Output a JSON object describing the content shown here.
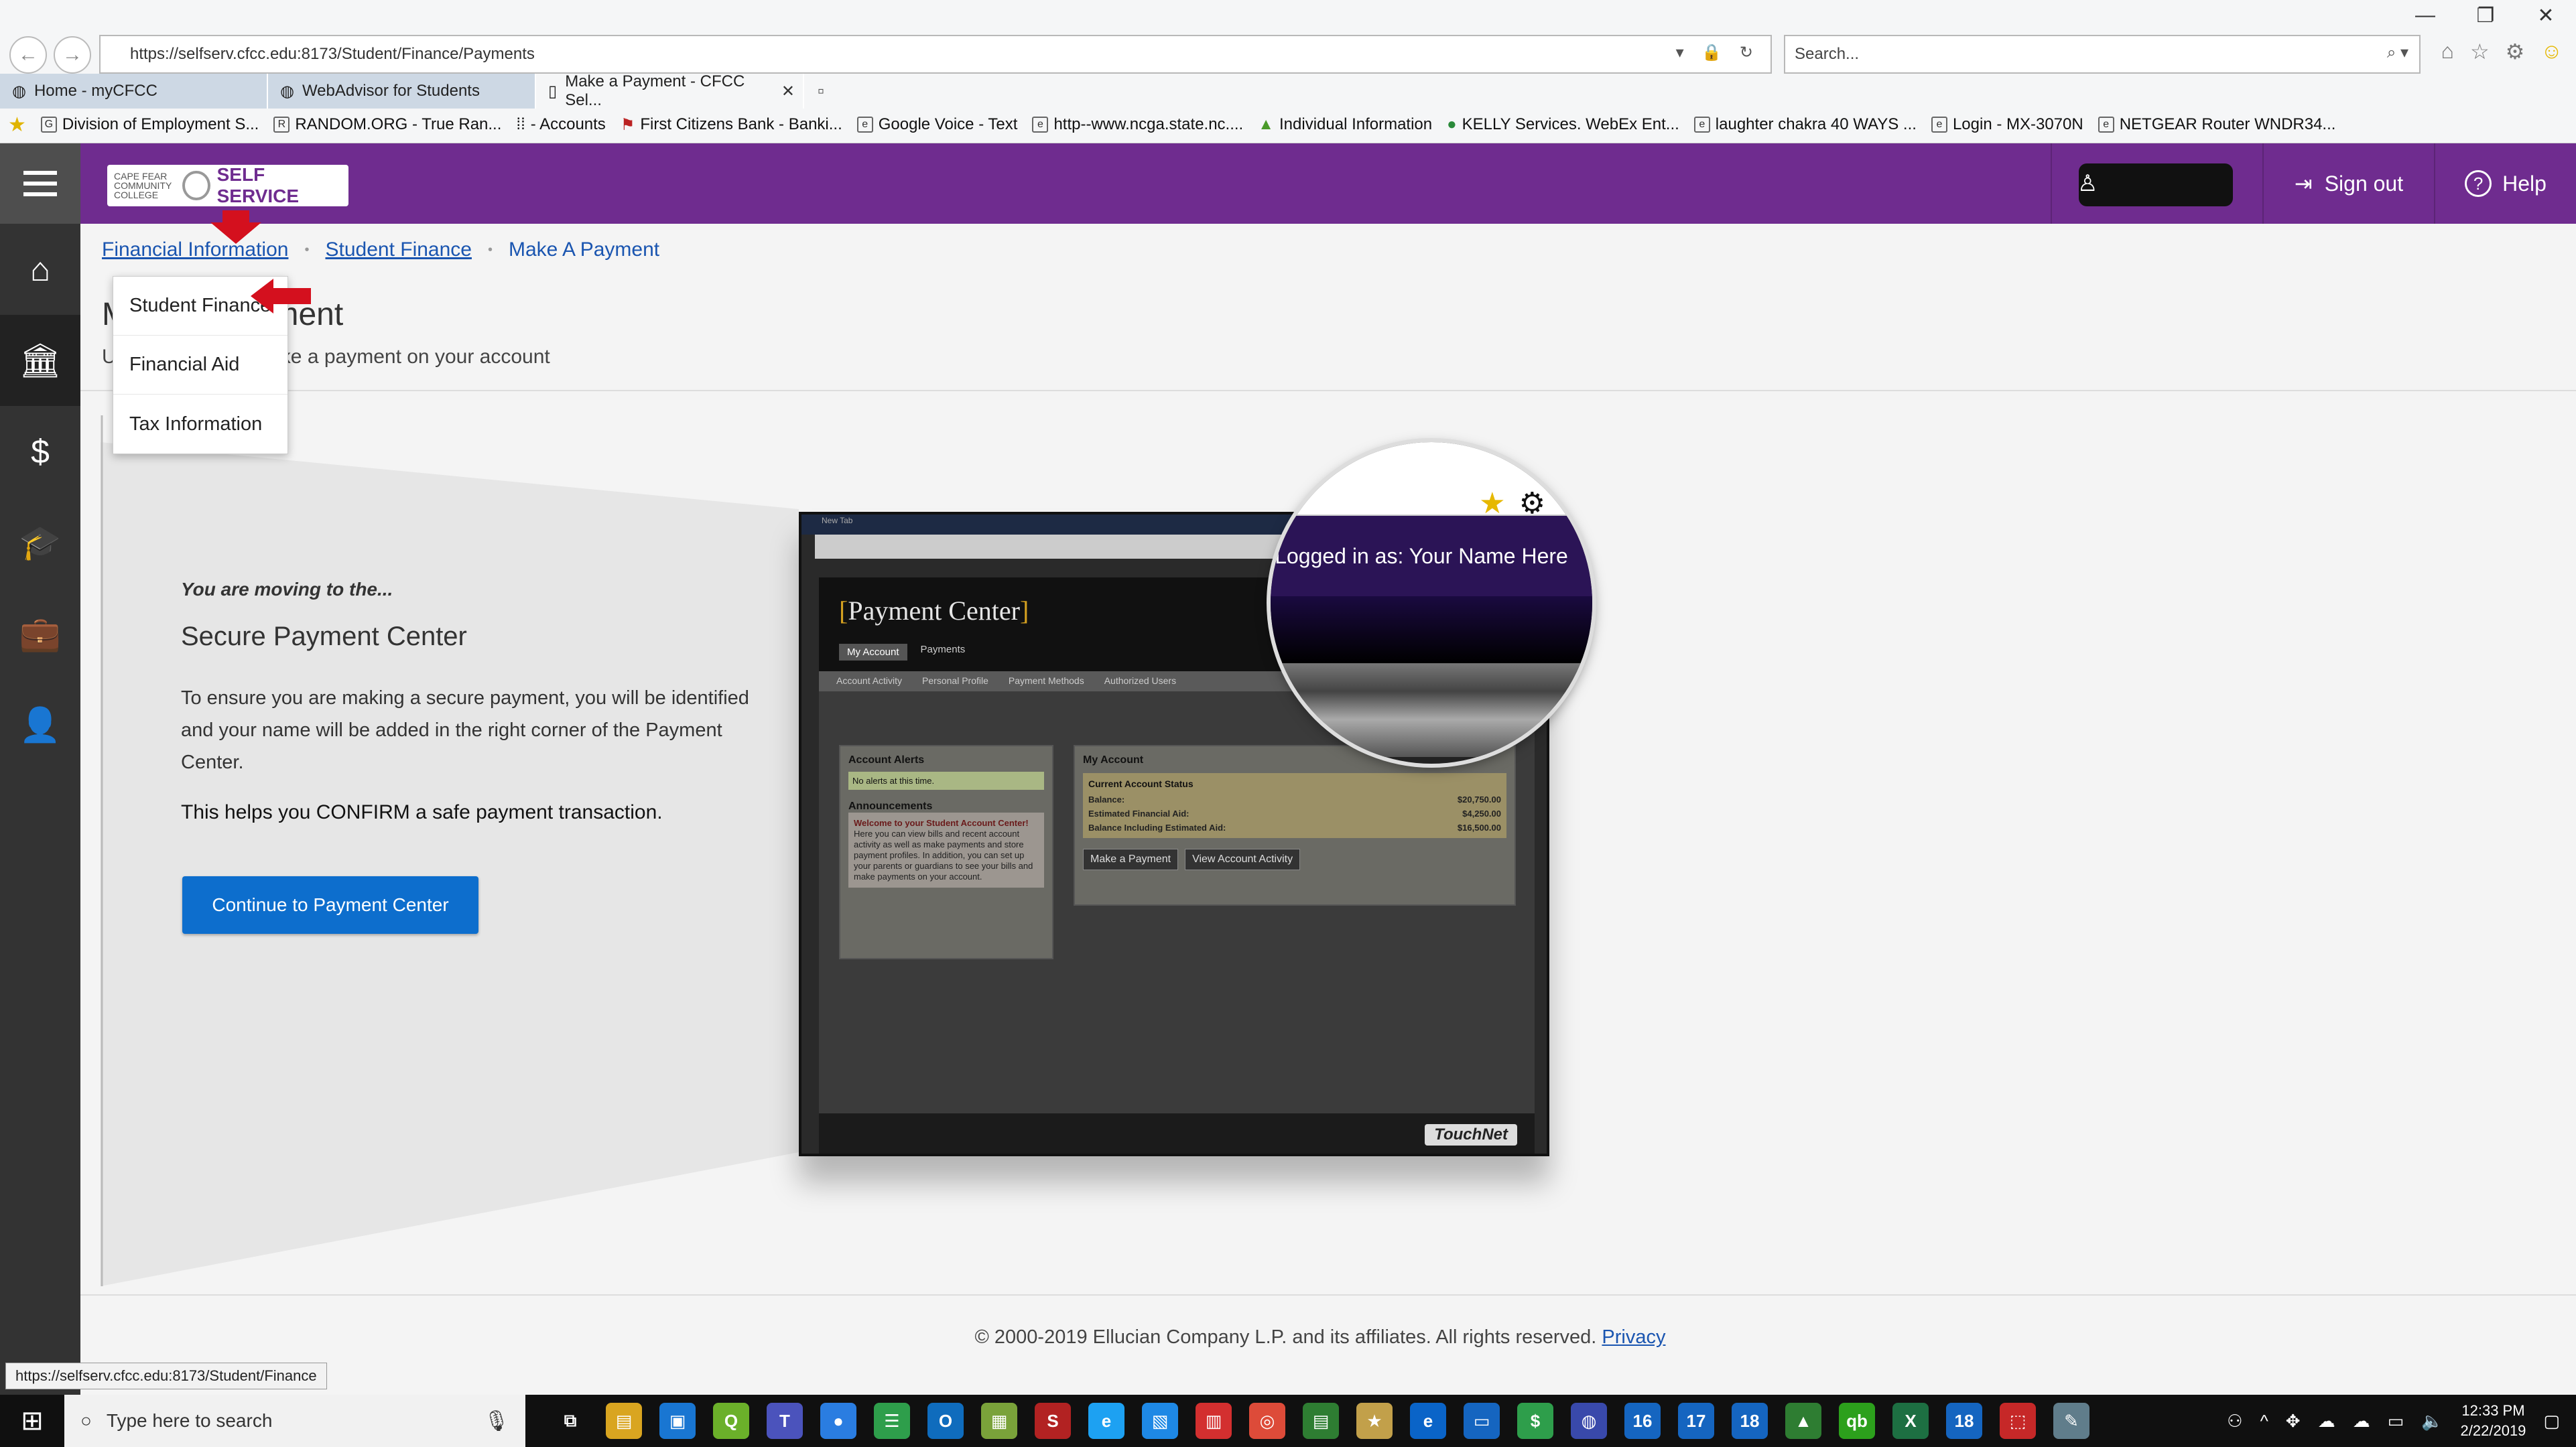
{
  "browser": {
    "window_controls": [
      "—",
      "❐",
      "✕"
    ],
    "address": "https://selfserv.cfcc.edu:8173/Student/Finance/Payments",
    "search_placeholder": "Search...",
    "tabs": [
      {
        "label": "Home - myCFCC",
        "active": false
      },
      {
        "label": "WebAdvisor for Students",
        "active": false
      },
      {
        "label": "Make a Payment - CFCC Sel...",
        "active": true
      }
    ],
    "favorites": [
      "Division of Employment S...",
      "RANDOM.ORG - True Ran...",
      "- Accounts",
      "First Citizens Bank - Banki...",
      "Google Voice - Text",
      "http--www.ncga.state.nc....",
      "Individual Information",
      "KELLY Services. WebEx Ent...",
      "laughter chakra 40 WAYS ...",
      "Login - MX-3070N",
      "NETGEAR Router WNDR34..."
    ]
  },
  "header": {
    "logo_small": "CAPE FEAR COMMUNITY COLLEGE",
    "logo_label": "SELF SERVICE",
    "sign_out": "Sign out",
    "help": "Help",
    "brand_color": "#6f2c8f"
  },
  "sidebar": {
    "items": [
      {
        "icon": "home-icon",
        "glyph": "⌂"
      },
      {
        "icon": "bank-icon",
        "glyph": "🏛"
      },
      {
        "icon": "finance-icon",
        "glyph": "$"
      },
      {
        "icon": "graduation-cap-icon",
        "glyph": "🎓"
      },
      {
        "icon": "briefcase-icon",
        "glyph": "💼"
      },
      {
        "icon": "user-icon",
        "glyph": "👤"
      }
    ]
  },
  "breadcrumb": {
    "item1": "Financial Information",
    "item2": "Student Finance",
    "current": "Make A Payment"
  },
  "page": {
    "title": "Make A Payment",
    "subtitle": "Use this page to make a payment on your account"
  },
  "dropdown": {
    "items": [
      "Student Finance",
      "Financial Aid",
      "Tax Information"
    ]
  },
  "payment_info": {
    "moving_text": "You are moving to the...",
    "title": "Secure Payment Center",
    "description": "To ensure you are making a secure payment, you will be identified and your name will be added in the right corner of the Payment Center.",
    "confirm": "This helps you CONFIRM a safe payment transaction.",
    "button": "Continue to Payment Center"
  },
  "mockup": {
    "tab": "New Tab",
    "pc_title": "Payment Center",
    "nav": [
      "My Account",
      "Payments"
    ],
    "subnav": [
      "Account Activity",
      "Personal Profile",
      "Payment Methods",
      "Authorized Users"
    ],
    "alerts_title": "Account Alerts",
    "alerts_none": "No alerts at this time.",
    "announcements_title": "Announcements",
    "announcement_head": "Welcome to your Student Account Center!",
    "announcement_body": "Here you can view bills and recent account activity as well as make payments and store payment profiles. In addition, you can set up your parents or guardians to see your bills and make payments on your account.",
    "account_title": "My Account",
    "status_title": "Current Account Status",
    "rows": [
      {
        "label": "Balance:",
        "value": "$20,750.00"
      },
      {
        "label": "Estimated Financial Aid:",
        "value": "$4,250.00"
      },
      {
        "label": "Balance Including Estimated Aid:",
        "value": "$16,500.00"
      }
    ],
    "btn_pay": "Make a Payment",
    "btn_activity": "View Account Activity",
    "touchnet": "TouchNet",
    "zoom_text": "Logged in as: Your Name Here"
  },
  "footer": {
    "copyright": "© 2000-2019 Ellucian Company L.P. and its affiliates. All rights reserved.",
    "privacy": "Privacy"
  },
  "status_url": "https://selfserv.cfcc.edu:8173/Student/Finance",
  "taskbar": {
    "search": "Type here to search",
    "time": "12:33 PM",
    "date": "2/22/2019",
    "apps": [
      {
        "name": "task-view",
        "glyph": "⧉",
        "color": "#101010"
      },
      {
        "name": "file-explorer",
        "glyph": "▤",
        "color": "#d9a520"
      },
      {
        "name": "store",
        "glyph": "▣",
        "color": "#1976d2"
      },
      {
        "name": "quickbooks-q",
        "glyph": "Q",
        "color": "#6bb02a"
      },
      {
        "name": "app-teams",
        "glyph": "T",
        "color": "#4b53bc"
      },
      {
        "name": "app-blue",
        "glyph": "●",
        "color": "#2a7de1"
      },
      {
        "name": "app-green",
        "glyph": "☰",
        "color": "#2e9e4b"
      },
      {
        "name": "outlook",
        "glyph": "O",
        "color": "#0f6cbd"
      },
      {
        "name": "app-folder",
        "glyph": "▦",
        "color": "#7aa23a"
      },
      {
        "name": "app-s",
        "glyph": "S",
        "color": "#b22222"
      },
      {
        "name": "internet-explorer",
        "glyph": "e",
        "color": "#1da1f2"
      },
      {
        "name": "app-doc",
        "glyph": "▧",
        "color": "#1e88e5"
      },
      {
        "name": "app-red",
        "glyph": "▥",
        "color": "#d32f2f"
      },
      {
        "name": "chrome",
        "glyph": "◎",
        "color": "#dd4b39"
      },
      {
        "name": "app-sheet",
        "glyph": "▤",
        "color": "#2e7d32"
      },
      {
        "name": "app-star",
        "glyph": "★",
        "color": "#c2a04a"
      },
      {
        "name": "edge",
        "glyph": "e",
        "color": "#0a64c8"
      },
      {
        "name": "app-window",
        "glyph": "▭",
        "color": "#1565c0"
      },
      {
        "name": "app-dollar",
        "glyph": "$",
        "color": "#2e9e4b"
      },
      {
        "name": "app-globe",
        "glyph": "◍",
        "color": "#3949ab"
      },
      {
        "name": "app-16",
        "glyph": "16",
        "color": "#1565c0"
      },
      {
        "name": "app-17",
        "glyph": "17",
        "color": "#1565c0"
      },
      {
        "name": "app-18a",
        "glyph": "18",
        "color": "#1565c0"
      },
      {
        "name": "app-chart",
        "glyph": "▲",
        "color": "#2e7d32"
      },
      {
        "name": "quickbooks",
        "glyph": "qb",
        "color": "#2ca01c"
      },
      {
        "name": "excel",
        "glyph": "X",
        "color": "#1d6f42"
      },
      {
        "name": "app-18b",
        "glyph": "18",
        "color": "#1565c0"
      },
      {
        "name": "acrobat",
        "glyph": "⬚",
        "color": "#c62828"
      },
      {
        "name": "app-paint",
        "glyph": "✎",
        "color": "#607d8b"
      }
    ]
  }
}
